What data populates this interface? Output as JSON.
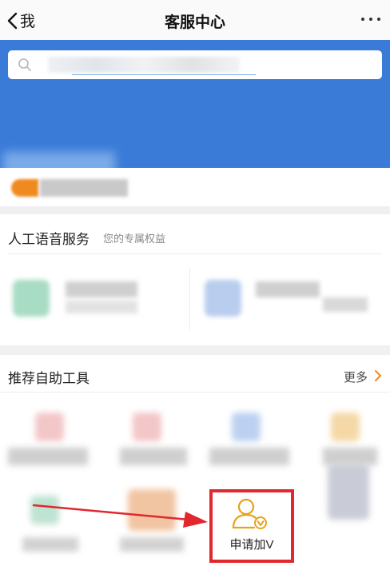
{
  "nav": {
    "back_label": "我",
    "title": "客服中心"
  },
  "voice_section": {
    "title": "人工语音服务",
    "subtitle": "您的专属权益"
  },
  "tools_section": {
    "title": "推荐自助工具",
    "more_label": "更多",
    "highlighted_tool": {
      "label": "申请加V",
      "icon": "user-verify-icon"
    }
  },
  "colors": {
    "hero_blue": "#3a7bd8",
    "accent_orange": "#f08a1f",
    "highlight_red": "#e0282e"
  },
  "icons": [
    "back-chevron-icon",
    "more-dots-icon",
    "search-icon",
    "chevron-right-icon",
    "user-verify-icon",
    "red-arrow"
  ]
}
